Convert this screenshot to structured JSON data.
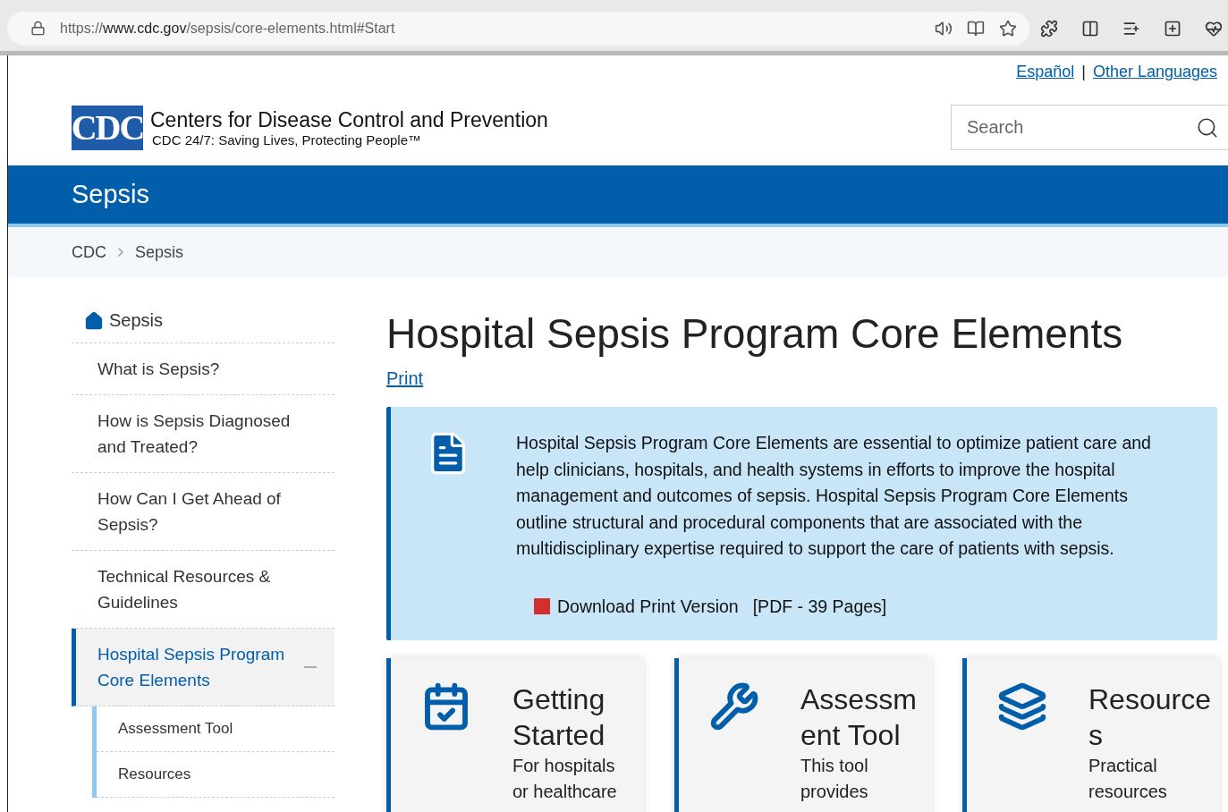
{
  "browser": {
    "url": "https://**www.cdc.gov**/sepsis/core-elements.html#Start"
  },
  "language_links": [
    {
      "label": "Español",
      "kind": "link"
    },
    {
      "label": "|",
      "kind": "separator"
    },
    {
      "label": "Other Languages",
      "kind": "link"
    }
  ],
  "header": {
    "logo_text": "CDC",
    "title": "Centers for Disease Control and Prevention",
    "tagline": "CDC 24/7: Saving Lives, Protecting People™",
    "search": {
      "placeholder": "Search"
    }
  },
  "banner": {
    "title": "Sepsis"
  },
  "breadcrumb": [
    "CDC",
    "Sepsis"
  ],
  "sidebar": {
    "home": "Sepsis",
    "items": [
      {
        "label": "What is Sepsis?",
        "selected": false
      },
      {
        "label": "How is Sepsis Diagnosed and Treated?",
        "selected": false
      },
      {
        "label": "How Can I Get Ahead of Sepsis?",
        "selected": false
      },
      {
        "label": "Technical Resources & Guidelines",
        "selected": false
      },
      {
        "label": "Hospital Sepsis Program Core Elements",
        "selected": true,
        "expanded": true,
        "children": [
          {
            "label": "Assessment Tool",
            "selected": false
          },
          {
            "label": "Resources",
            "selected": false
          }
        ]
      }
    ]
  },
  "main": {
    "title": "Hospital Sepsis Program Core Elements",
    "print_link": "Print",
    "callout": {
      "text": "Hospital Sepsis Program Core Elements are essential to optimize patient care and help clinicians, hospitals, and health systems in efforts to improve the hospital management and outcomes of sepsis. Hospital Sepsis Program Core Elements outline structural and procedural components that are associated with the multidisciplinary expertise required to support the care of patients with sepsis.",
      "download_link": "Download Print Version",
      "file_info": "[PDF - 39 Pages]"
    },
    "cards": [
      {
        "kind": "calendar",
        "title": "Getting Started",
        "description": "For hospitals or healthcare"
      },
      {
        "kind": "tools",
        "title": "Assessment Tool",
        "description": "This tool provides"
      },
      {
        "kind": "layers",
        "title": "Resources",
        "description": "Practical resources"
      }
    ]
  }
}
